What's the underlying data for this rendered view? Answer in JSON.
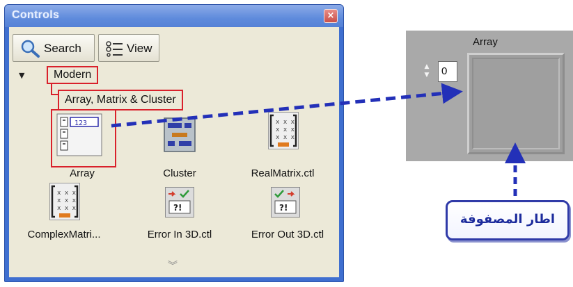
{
  "window": {
    "title": "Controls",
    "close_glyph": "×"
  },
  "toolbar": {
    "search_label": "Search",
    "view_label": "View"
  },
  "tree": {
    "root_label": "Modern",
    "sub_label": "Array, Matrix & Cluster"
  },
  "palette_items": [
    {
      "label": "Array",
      "icon": "array-icon"
    },
    {
      "label": "Cluster",
      "icon": "cluster-icon"
    },
    {
      "label": "RealMatrix.ctl",
      "icon": "real-matrix-icon"
    },
    {
      "label": "ComplexMatri...",
      "icon": "complex-matrix-icon"
    },
    {
      "label": "Error In 3D.ctl",
      "icon": "error-in-icon"
    },
    {
      "label": "Error Out 3D.ctl",
      "icon": "error-out-icon"
    }
  ],
  "icon_glyphs": {
    "array_value": "123",
    "matrix_cell": "x",
    "error_text": "?!"
  },
  "array_control": {
    "label": "Array",
    "index_value": "0"
  },
  "callout": {
    "text": "اطار المصفوفة"
  },
  "colors": {
    "highlight": "#d9212b",
    "arrow": "#2330b8",
    "titlebar": "#5f8bdc"
  }
}
